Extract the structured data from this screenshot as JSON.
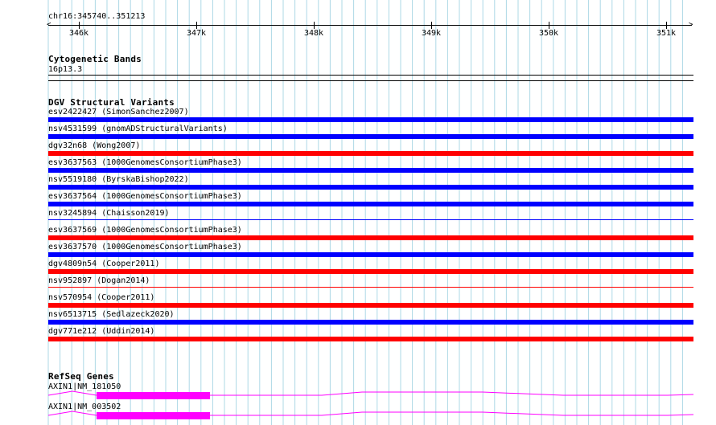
{
  "colors": {
    "grid": "#add8e6",
    "loss": "#ff0000",
    "gain": "#0000ff",
    "gene": "#ff00ff"
  },
  "ruler": {
    "location": "chr16:345740..351213",
    "ticks": [
      "346k",
      "347k",
      "348k",
      "349k",
      "350k",
      "351k"
    ]
  },
  "cytoband": {
    "title": "Cytogenetic Bands",
    "band": "16p13.3"
  },
  "dgv": {
    "title": "DGV Structural Variants",
    "variants": [
      {
        "label": "esv2422427 (SimonSanchez2007)",
        "type": "gain"
      },
      {
        "label": "nsv4531599 (gnomADStructuralVariants)",
        "type": "gain"
      },
      {
        "label": "dgv32n68 (Wong2007)",
        "type": "loss"
      },
      {
        "label": "esv3637563 (1000GenomesConsortiumPhase3)",
        "type": "gain"
      },
      {
        "label": "nsv5519180 (ByrskaBishop2022)",
        "type": "gain"
      },
      {
        "label": "esv3637564 (1000GenomesConsortiumPhase3)",
        "type": "gain"
      },
      {
        "label": "nsv3245894 (Chaisson2019)",
        "type": "gain-thin"
      },
      {
        "label": "esv3637569 (1000GenomesConsortiumPhase3)",
        "type": "loss"
      },
      {
        "label": "esv3637570 (1000GenomesConsortiumPhase3)",
        "type": "gain"
      },
      {
        "label": "dgv4809n54 (Cooper2011)",
        "type": "loss"
      },
      {
        "label": "nsv952897 (Dogan2014)",
        "type": "loss-thin"
      },
      {
        "label": "nsv570954 (Cooper2011)",
        "type": "loss"
      },
      {
        "label": "nsv6513715 (Sedlazeck2020)",
        "type": "gain"
      },
      {
        "label": "dgv771e212 (Uddin2014)",
        "type": "loss"
      }
    ]
  },
  "refseq": {
    "title": "RefSeq Genes",
    "transcripts": [
      {
        "label": "AXIN1|NM_181050"
      },
      {
        "label": "AXIN1|NM_003502"
      }
    ]
  }
}
